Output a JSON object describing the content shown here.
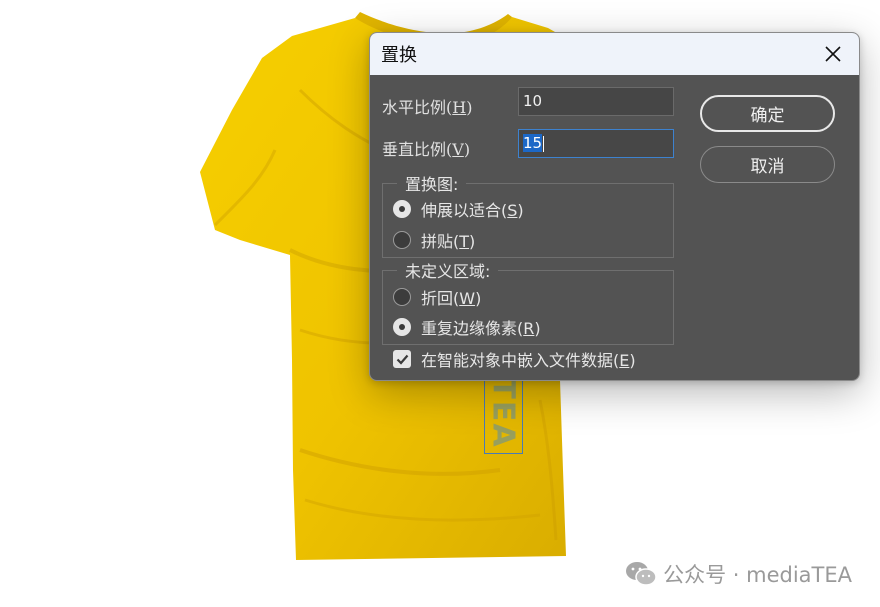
{
  "dialog": {
    "title": "置换",
    "horizontal_scale": {
      "label": "水平比例(",
      "key": "H",
      "suffix": ")",
      "value": "10"
    },
    "vertical_scale": {
      "label": "垂直比例(",
      "key": "V",
      "suffix": ")",
      "value": "15"
    },
    "ok_label": "确定",
    "cancel_label": "取消",
    "displacement_map": {
      "legend": "置换图:",
      "options": [
        {
          "label": "伸展以适合(",
          "key": "S",
          "suffix": ")",
          "checked": true
        },
        {
          "label": "拼贴(",
          "key": "T",
          "suffix": ")",
          "checked": false
        }
      ]
    },
    "undefined_areas": {
      "legend": "未定义区域:",
      "options": [
        {
          "label": "折回(",
          "key": "W",
          "suffix": ")",
          "checked": false
        },
        {
          "label": "重复边缘像素(",
          "key": "R",
          "suffix": ")",
          "checked": true
        }
      ]
    },
    "embed_data": {
      "label": "在智能对象中嵌入文件数据(",
      "key": "E",
      "suffix": ")",
      "checked": true
    }
  },
  "canvas": {
    "text_layer": "TEA",
    "shirt_color": "#F2C500"
  },
  "watermark": {
    "text": "公众号 · mediaTEA"
  },
  "colors": {
    "dialog_bg": "#535353",
    "titlebar_bg": "#EFF3FA",
    "focus_accent": "#3D82CF"
  }
}
